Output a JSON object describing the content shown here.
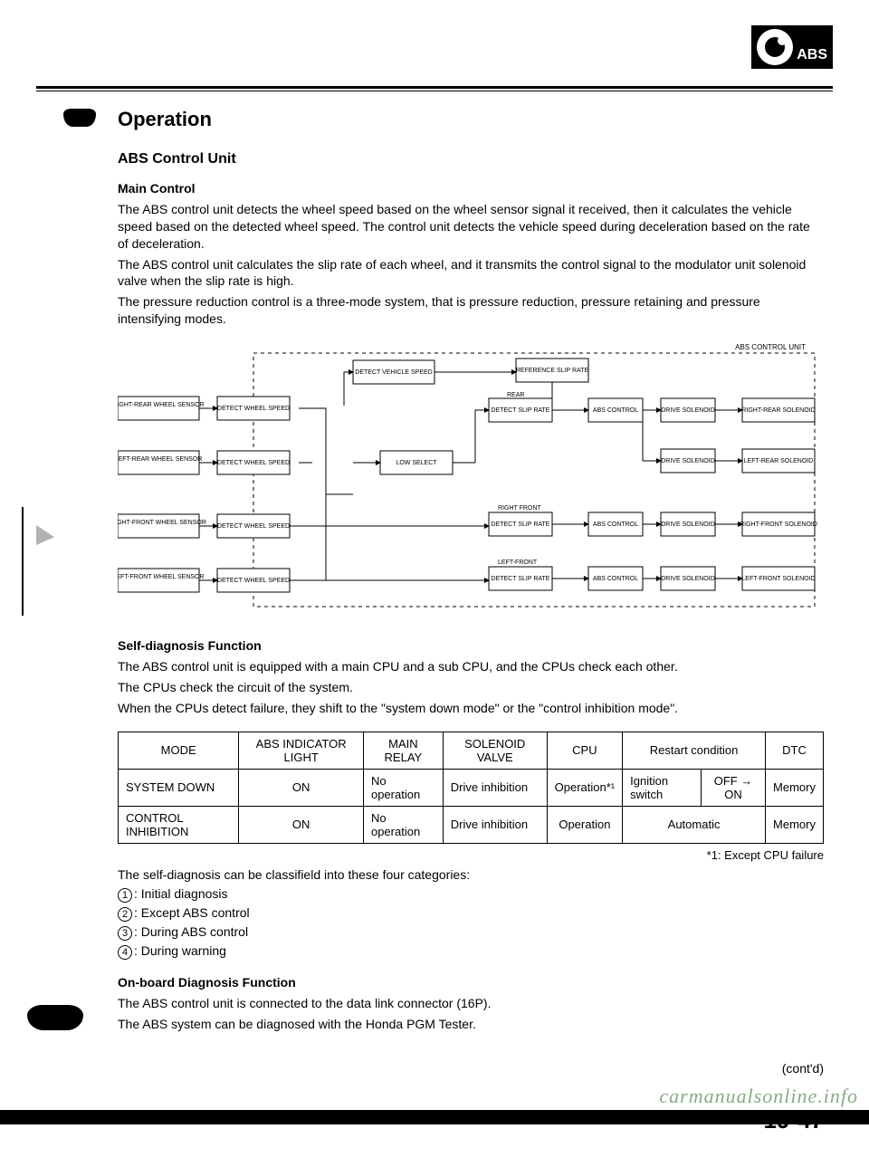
{
  "badge": {
    "label": "ABS"
  },
  "heading": "Operation",
  "subheading": "ABS Control Unit",
  "main_control": {
    "title": "Main Control",
    "p1": "The ABS control unit detects the wheel speed based on the wheel sensor signal it received, then it calculates the vehicle speed based on the detected wheel speed. The control unit detects the vehicle speed during deceleration based on the rate of deceleration.",
    "p2": "The ABS control unit calculates the slip rate of each wheel, and it transmits the control signal to the modulator unit solenoid valve when the slip rate is high.",
    "p3": "The pressure reduction control is a three-mode system, that is pressure reduction, pressure retaining and pressure intensifying modes."
  },
  "diagram": {
    "title": "ABS CONTROL UNIT",
    "left_sensors": [
      "RIGHT-REAR WHEEL SENSOR",
      "LEFT-REAR WHEEL SENSOR",
      "RIGHT-FRONT WHEEL SENSOR",
      "LEFT-FRONT WHEEL SENSOR"
    ],
    "detect_wspeed": "DETECT WHEEL SPEED",
    "detect_vspeed": "DETECT VEHICLE SPEED",
    "low_select": "LOW SELECT",
    "ref_slip": "REFERENCE SLIP RATE",
    "rear_label": "REAR",
    "detect_slip": "DETECT SLIP RATE",
    "rf_label": "RIGHT FRONT",
    "lf_label": "LEFT-FRONT",
    "abs_control": "ABS CONTROL",
    "drive_sol": "DRIVE SOLENOID",
    "right_rear_sol": "RIGHT-REAR SOLENOID",
    "left_rear_sol": "LEFT-REAR SOLENOID",
    "right_front_sol": "RIGHT-FRONT SOLENOID",
    "left_front_sol": "LEFT-FRONT SOLENOID"
  },
  "self_diag": {
    "title": "Self-diagnosis Function",
    "p1": "The ABS control unit is equipped with a main CPU and a sub CPU, and the CPUs check each other.",
    "p2": "The CPUs check the circuit of the system.",
    "p3": "When the CPUs detect failure, they shift to the \"system down mode\" or the \"control inhibition mode\"."
  },
  "table": {
    "headers": {
      "mode": "MODE",
      "abs_light": "ABS INDICATOR LIGHT",
      "main_relay": "MAIN RELAY",
      "sol_valve": "SOLENOID VALVE",
      "cpu": "CPU",
      "restart": "Restart condition",
      "dtc": "DTC"
    },
    "rows": [
      {
        "mode": "SYSTEM DOWN",
        "light": "ON",
        "relay": "No operation",
        "valve": "Drive inhibition",
        "cpu": "Operation*¹",
        "restart_a": "Ignition switch",
        "restart_b": "OFF → ON",
        "dtc": "Memory"
      },
      {
        "mode": "CONTROL INHIBITION",
        "light": "ON",
        "relay": "No operation",
        "valve": "Drive inhibition",
        "cpu": "Operation",
        "restart": "Automatic",
        "dtc": "Memory"
      }
    ],
    "footnote": "*1: Except CPU failure"
  },
  "categories": {
    "intro": "The self-diagnosis can be classifield into these four categories:",
    "c1": "Initial diagnosis",
    "c2": "Except ABS control",
    "c3": "During ABS control",
    "c4": "During warning"
  },
  "onboard": {
    "title": "On-board Diagnosis Function",
    "p1": "The ABS control unit is connected to the data link connector (16P).",
    "p2": "The ABS system can be diagnosed with the Honda PGM Tester."
  },
  "contd": "(cont'd)",
  "page_number": "19-47",
  "watermark": "carmanualsonline.info"
}
